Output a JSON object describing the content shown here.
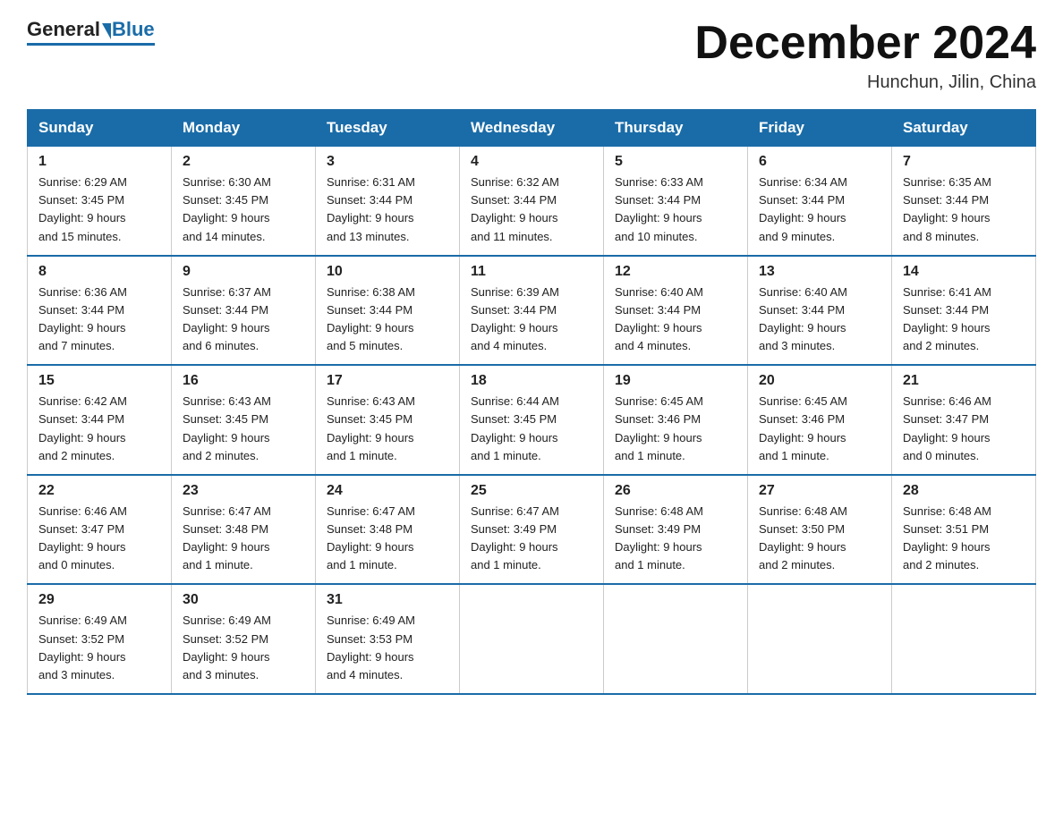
{
  "header": {
    "logo_general": "General",
    "logo_blue": "Blue",
    "month_title": "December 2024",
    "location": "Hunchun, Jilin, China"
  },
  "weekdays": [
    "Sunday",
    "Monday",
    "Tuesday",
    "Wednesday",
    "Thursday",
    "Friday",
    "Saturday"
  ],
  "weeks": [
    [
      {
        "day": "1",
        "sunrise": "6:29 AM",
        "sunset": "3:45 PM",
        "daylight": "9 hours and 15 minutes."
      },
      {
        "day": "2",
        "sunrise": "6:30 AM",
        "sunset": "3:45 PM",
        "daylight": "9 hours and 14 minutes."
      },
      {
        "day": "3",
        "sunrise": "6:31 AM",
        "sunset": "3:44 PM",
        "daylight": "9 hours and 13 minutes."
      },
      {
        "day": "4",
        "sunrise": "6:32 AM",
        "sunset": "3:44 PM",
        "daylight": "9 hours and 11 minutes."
      },
      {
        "day": "5",
        "sunrise": "6:33 AM",
        "sunset": "3:44 PM",
        "daylight": "9 hours and 10 minutes."
      },
      {
        "day": "6",
        "sunrise": "6:34 AM",
        "sunset": "3:44 PM",
        "daylight": "9 hours and 9 minutes."
      },
      {
        "day": "7",
        "sunrise": "6:35 AM",
        "sunset": "3:44 PM",
        "daylight": "9 hours and 8 minutes."
      }
    ],
    [
      {
        "day": "8",
        "sunrise": "6:36 AM",
        "sunset": "3:44 PM",
        "daylight": "9 hours and 7 minutes."
      },
      {
        "day": "9",
        "sunrise": "6:37 AM",
        "sunset": "3:44 PM",
        "daylight": "9 hours and 6 minutes."
      },
      {
        "day": "10",
        "sunrise": "6:38 AM",
        "sunset": "3:44 PM",
        "daylight": "9 hours and 5 minutes."
      },
      {
        "day": "11",
        "sunrise": "6:39 AM",
        "sunset": "3:44 PM",
        "daylight": "9 hours and 4 minutes."
      },
      {
        "day": "12",
        "sunrise": "6:40 AM",
        "sunset": "3:44 PM",
        "daylight": "9 hours and 4 minutes."
      },
      {
        "day": "13",
        "sunrise": "6:40 AM",
        "sunset": "3:44 PM",
        "daylight": "9 hours and 3 minutes."
      },
      {
        "day": "14",
        "sunrise": "6:41 AM",
        "sunset": "3:44 PM",
        "daylight": "9 hours and 2 minutes."
      }
    ],
    [
      {
        "day": "15",
        "sunrise": "6:42 AM",
        "sunset": "3:44 PM",
        "daylight": "9 hours and 2 minutes."
      },
      {
        "day": "16",
        "sunrise": "6:43 AM",
        "sunset": "3:45 PM",
        "daylight": "9 hours and 2 minutes."
      },
      {
        "day": "17",
        "sunrise": "6:43 AM",
        "sunset": "3:45 PM",
        "daylight": "9 hours and 1 minute."
      },
      {
        "day": "18",
        "sunrise": "6:44 AM",
        "sunset": "3:45 PM",
        "daylight": "9 hours and 1 minute."
      },
      {
        "day": "19",
        "sunrise": "6:45 AM",
        "sunset": "3:46 PM",
        "daylight": "9 hours and 1 minute."
      },
      {
        "day": "20",
        "sunrise": "6:45 AM",
        "sunset": "3:46 PM",
        "daylight": "9 hours and 1 minute."
      },
      {
        "day": "21",
        "sunrise": "6:46 AM",
        "sunset": "3:47 PM",
        "daylight": "9 hours and 0 minutes."
      }
    ],
    [
      {
        "day": "22",
        "sunrise": "6:46 AM",
        "sunset": "3:47 PM",
        "daylight": "9 hours and 0 minutes."
      },
      {
        "day": "23",
        "sunrise": "6:47 AM",
        "sunset": "3:48 PM",
        "daylight": "9 hours and 1 minute."
      },
      {
        "day": "24",
        "sunrise": "6:47 AM",
        "sunset": "3:48 PM",
        "daylight": "9 hours and 1 minute."
      },
      {
        "day": "25",
        "sunrise": "6:47 AM",
        "sunset": "3:49 PM",
        "daylight": "9 hours and 1 minute."
      },
      {
        "day": "26",
        "sunrise": "6:48 AM",
        "sunset": "3:49 PM",
        "daylight": "9 hours and 1 minute."
      },
      {
        "day": "27",
        "sunrise": "6:48 AM",
        "sunset": "3:50 PM",
        "daylight": "9 hours and 2 minutes."
      },
      {
        "day": "28",
        "sunrise": "6:48 AM",
        "sunset": "3:51 PM",
        "daylight": "9 hours and 2 minutes."
      }
    ],
    [
      {
        "day": "29",
        "sunrise": "6:49 AM",
        "sunset": "3:52 PM",
        "daylight": "9 hours and 3 minutes."
      },
      {
        "day": "30",
        "sunrise": "6:49 AM",
        "sunset": "3:52 PM",
        "daylight": "9 hours and 3 minutes."
      },
      {
        "day": "31",
        "sunrise": "6:49 AM",
        "sunset": "3:53 PM",
        "daylight": "9 hours and 4 minutes."
      },
      null,
      null,
      null,
      null
    ]
  ],
  "labels": {
    "sunrise": "Sunrise:",
    "sunset": "Sunset:",
    "daylight": "Daylight:"
  }
}
